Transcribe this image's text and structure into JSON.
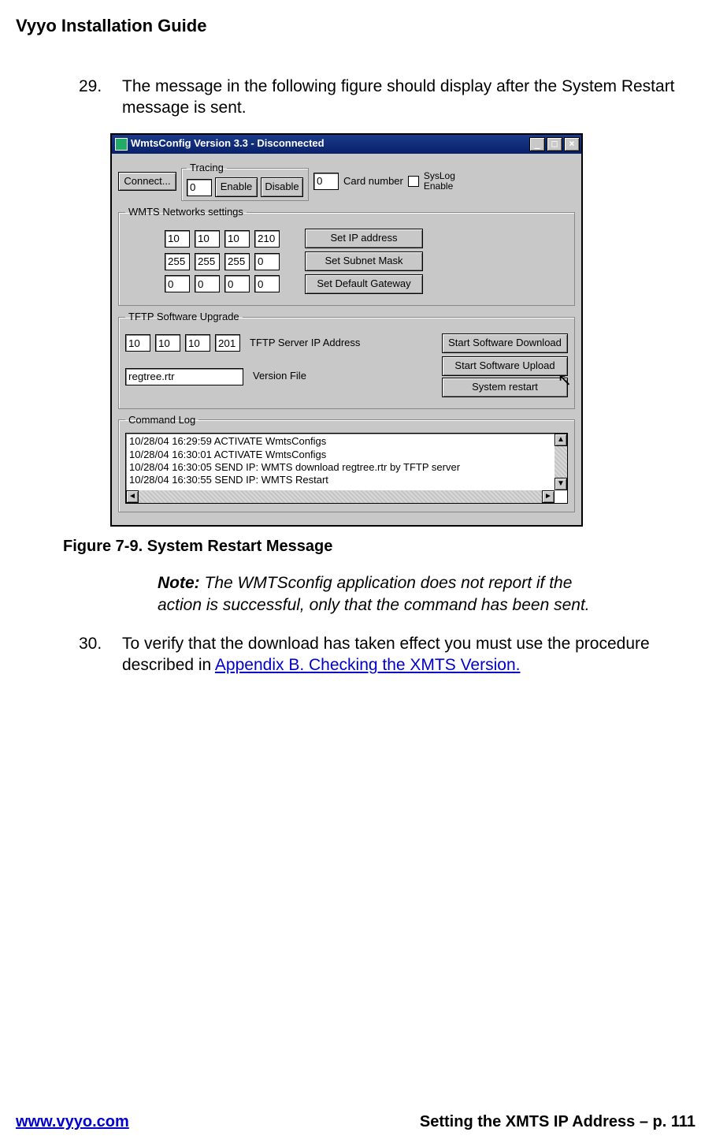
{
  "header": "Vyyo Installation Guide",
  "steps": {
    "s29_num": "29.",
    "s29_txt": "The message in the following figure should display after the System Restart message is sent.",
    "s30_num": "30.",
    "s30_txt_a": "To verify that the download has taken effect you must use the procedure described in ",
    "s30_link": "Appendix B.  Checking the XMTS Version."
  },
  "figcap": "Figure 7-9. System Restart Message",
  "note_label": "Note:",
  "note_body": " The WMTSconfig application does not report if the action is successful, only that the command has been sent.",
  "footer": {
    "url": "www.vyyo.com",
    "right": "Setting the XMTS IP Address – p. 111"
  },
  "dlg": {
    "title": "WmtsConfig Version 3.3 - Disconnected",
    "connect": "Connect...",
    "tracing_legend": "Tracing",
    "tracing_val": "0",
    "enable": "Enable",
    "disable": "Disable",
    "card_val": "0",
    "card_label": "Card number",
    "syslog": "SysLog Enable",
    "net_legend": "WMTS Networks settings",
    "ip": [
      "10",
      "10",
      "10",
      "210"
    ],
    "mask": [
      "255",
      "255",
      "255",
      "0"
    ],
    "gw": [
      "0",
      "0",
      "0",
      "0"
    ],
    "btn_ip": "Set IP address",
    "btn_mask": "Set Subnet Mask",
    "btn_gw": "Set Default Gateway",
    "tftp_legend": "TFTP Software Upgrade",
    "tftp_ip": [
      "10",
      "10",
      "10",
      "201"
    ],
    "tftp_label": "TFTP Server IP Address",
    "ver_file": "regtree.rtr",
    "ver_label": "Version File",
    "btn_dl": "Start Software Download",
    "btn_ul": "Start Software Upload",
    "btn_restart": "System restart",
    "log_legend": "Command Log",
    "log": [
      "10/28/04 16:29:59 ACTIVATE WmtsConfigs",
      "10/28/04 16:30:01 ACTIVATE WmtsConfigs",
      "10/28/04 16:30:05 SEND IP: WMTS download regtree.rtr by TFTP server",
      "10/28/04 16:30:55 SEND IP: WMTS Restart"
    ]
  }
}
